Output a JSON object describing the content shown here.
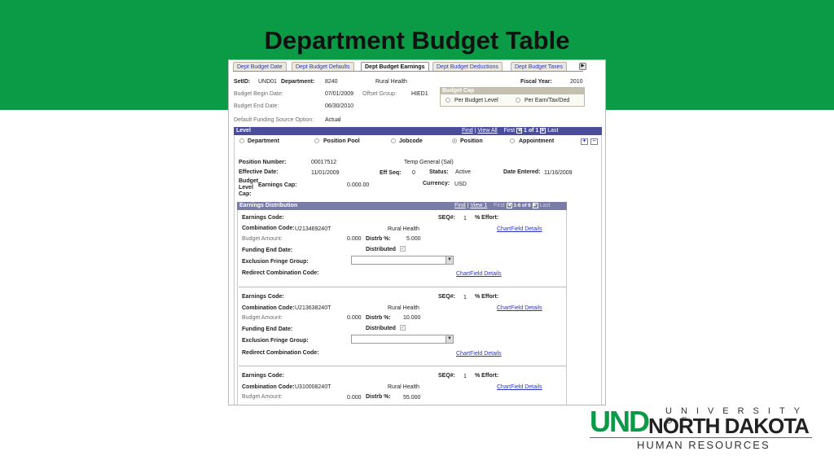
{
  "slide": {
    "title": "Department Budget Table",
    "banner_color": "#0b9b46"
  },
  "tabs": [
    {
      "label": "Dept Budget Date",
      "active": false
    },
    {
      "label": "Dept Budget Defaults",
      "active": false
    },
    {
      "label": "Dept Budget Earnings",
      "active": true
    },
    {
      "label": "Dept Budget Deductions",
      "active": false
    },
    {
      "label": "Dept Budget Taxes",
      "active": false
    }
  ],
  "header": {
    "setid_label": "SetID:",
    "setid_value": "UND01",
    "department_label": "Department:",
    "department_value": "8240",
    "department_desc": "Rural Health",
    "fiscal_year_label": "Fiscal Year:",
    "fiscal_year_value": "2010",
    "budget_begin_label": "Budget Begin Date:",
    "budget_begin_value": "07/01/2009",
    "offset_group_label": "Offset Group:",
    "offset_group_value": "HIED1",
    "budget_end_label": "Budget End Date:",
    "budget_end_value": "06/30/2010",
    "funding_source_label": "Default Funding Source Option:",
    "funding_source_value": "Actual"
  },
  "budget_cap": {
    "title": "Budget Cap",
    "option1": "Per Budget Level",
    "option2": "Per Earn/Tax/Ded"
  },
  "level": {
    "title": "Level",
    "find": "Find",
    "view_all": "View All",
    "first": "First",
    "count": "1 of 1",
    "last": "Last",
    "options": [
      "Department",
      "Position Pool",
      "Jobcode",
      "Position",
      "Appointment"
    ],
    "selected": "Position",
    "add_label": "+",
    "remove_label": "−",
    "position_number_label": "Position Number:",
    "position_number_value": "00017512",
    "position_desc": "Temp General (Sal)",
    "effective_date_label": "Effective Date:",
    "effective_date_value": "11/01/2009",
    "eff_seq_label": "Eff Seq:",
    "eff_seq_value": "0",
    "status_label": "Status:",
    "status_value": "Active",
    "date_entered_label": "Date Entered:",
    "date_entered_value": "11/16/2009",
    "budget_level_cap_label1": "Budget",
    "budget_level_cap_label2": "Level",
    "budget_level_cap_label3": "Cap:",
    "earnings_cap_label": "Earnings Cap:",
    "earnings_cap_value": "0.000.00",
    "currency_label": "Currency:",
    "currency_value": "USD"
  },
  "distribution": {
    "title": "Earnings Distribution",
    "find": "Find",
    "view": "View 1",
    "first": "First",
    "count": "1-6 of 6",
    "last": "Last",
    "labels": {
      "earnings_code": "Earnings Code:",
      "seq": "SEQ#:",
      "effort": "% Effort:",
      "combination_code": "Combination Code:",
      "chartfield": "ChartField Details",
      "budget_amount": "Budget Amount:",
      "distrb": "Distrb %:",
      "funding_end": "Funding End Date:",
      "distributed": "Distributed",
      "exclusion_fringe": "Exclusion Fringe Group:",
      "redirect": "Redirect Combination Code:"
    },
    "rows": [
      {
        "seq": "1",
        "combination_code": "U213469240T",
        "desc": "Rural Health",
        "budget_amount": "0.000",
        "distrb": "5.000"
      },
      {
        "seq": "1",
        "combination_code": "U213638240T",
        "desc": "Rural Health",
        "budget_amount": "0.000",
        "distrb": "10.000"
      },
      {
        "seq": "1",
        "combination_code": "U310008240T",
        "desc": "Rural Health",
        "budget_amount": "0.000",
        "distrb": "55.000"
      }
    ]
  },
  "logo": {
    "und": "UND",
    "university_of": "UNIVERSITY OF",
    "north_dakota": "NORTH DAKOTA",
    "human_resources": "HUMAN RESOURCES"
  }
}
